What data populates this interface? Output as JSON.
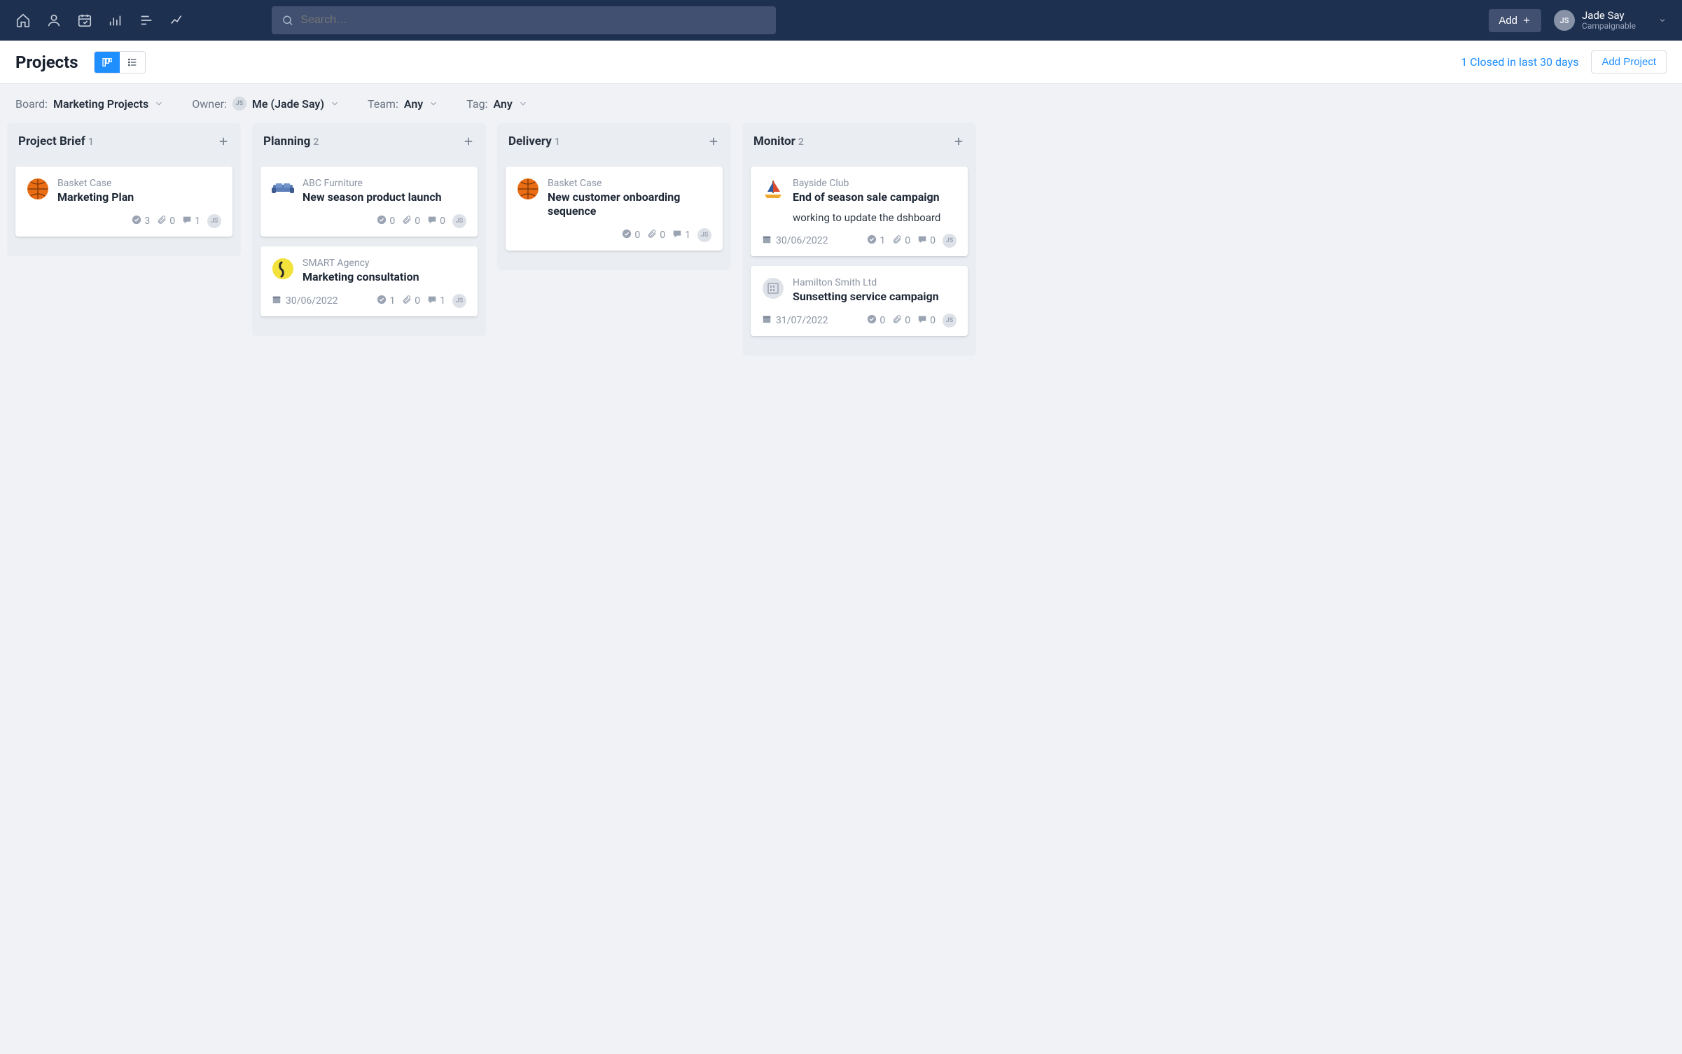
{
  "nav": {
    "search_placeholder": "Search…",
    "add_label": "Add",
    "user": {
      "initials": "JS",
      "name": "Jade Say",
      "org": "Campaignable"
    }
  },
  "header": {
    "page_title": "Projects",
    "closed_link": "1 Closed in last 30 days",
    "add_project": "Add Project"
  },
  "filters": {
    "board_label": "Board:",
    "board_value": "Marketing Projects",
    "owner_label": "Owner:",
    "owner_value": "Me (Jade Say)",
    "owner_initials": "JS",
    "team_label": "Team:",
    "team_value": "Any",
    "tag_label": "Tag:",
    "tag_value": "Any"
  },
  "columns": [
    {
      "title": "Project Brief",
      "count": "1",
      "cards": [
        {
          "client": "Basket Case",
          "title": "Marketing Plan",
          "avatar": "basket",
          "date": "",
          "tasks": "3",
          "attach": "0",
          "comments": "1",
          "assignee": "JS",
          "note": ""
        }
      ]
    },
    {
      "title": "Planning",
      "count": "2",
      "cards": [
        {
          "client": "ABC Furniture",
          "title": "New season product launch",
          "avatar": "furn",
          "date": "",
          "tasks": "0",
          "attach": "0",
          "comments": "0",
          "assignee": "JS",
          "note": ""
        },
        {
          "client": "SMART Agency",
          "title": "Marketing consultation",
          "avatar": "smart",
          "date": "30/06/2022",
          "tasks": "1",
          "attach": "0",
          "comments": "1",
          "assignee": "JS",
          "note": ""
        }
      ]
    },
    {
      "title": "Delivery",
      "count": "1",
      "cards": [
        {
          "client": "Basket Case",
          "title": "New customer onboarding sequence",
          "avatar": "basket",
          "date": "",
          "tasks": "0",
          "attach": "0",
          "comments": "1",
          "assignee": "JS",
          "note": ""
        }
      ]
    },
    {
      "title": "Monitor",
      "count": "2",
      "cards": [
        {
          "client": "Bayside Club",
          "title": "End of season sale campaign",
          "avatar": "sail",
          "date": "30/06/2022",
          "tasks": "1",
          "attach": "0",
          "comments": "0",
          "assignee": "JS",
          "note": "working to update the dshboard"
        },
        {
          "client": "Hamilton Smith Ltd",
          "title": "Sunsetting service campaign",
          "avatar": "ham",
          "date": "31/07/2022",
          "tasks": "0",
          "attach": "0",
          "comments": "0",
          "assignee": "JS",
          "note": ""
        }
      ]
    }
  ]
}
